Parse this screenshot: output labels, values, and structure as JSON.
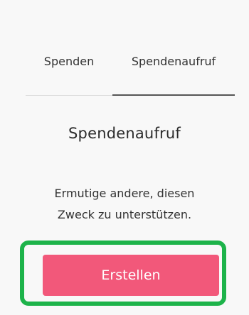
{
  "tabs": [
    {
      "label": "Spenden",
      "active": false
    },
    {
      "label": "Spendenaufruf",
      "active": true
    }
  ],
  "appeal": {
    "heading": "Spendenaufruf",
    "description_line1": "Ermutige andere, diesen",
    "description_line2": "Zweck zu unterstützen.",
    "create_button_label": "Erstellen"
  },
  "colors": {
    "button": "#f2587a",
    "highlight": "#1db34a",
    "tab_underline": "#555555"
  }
}
